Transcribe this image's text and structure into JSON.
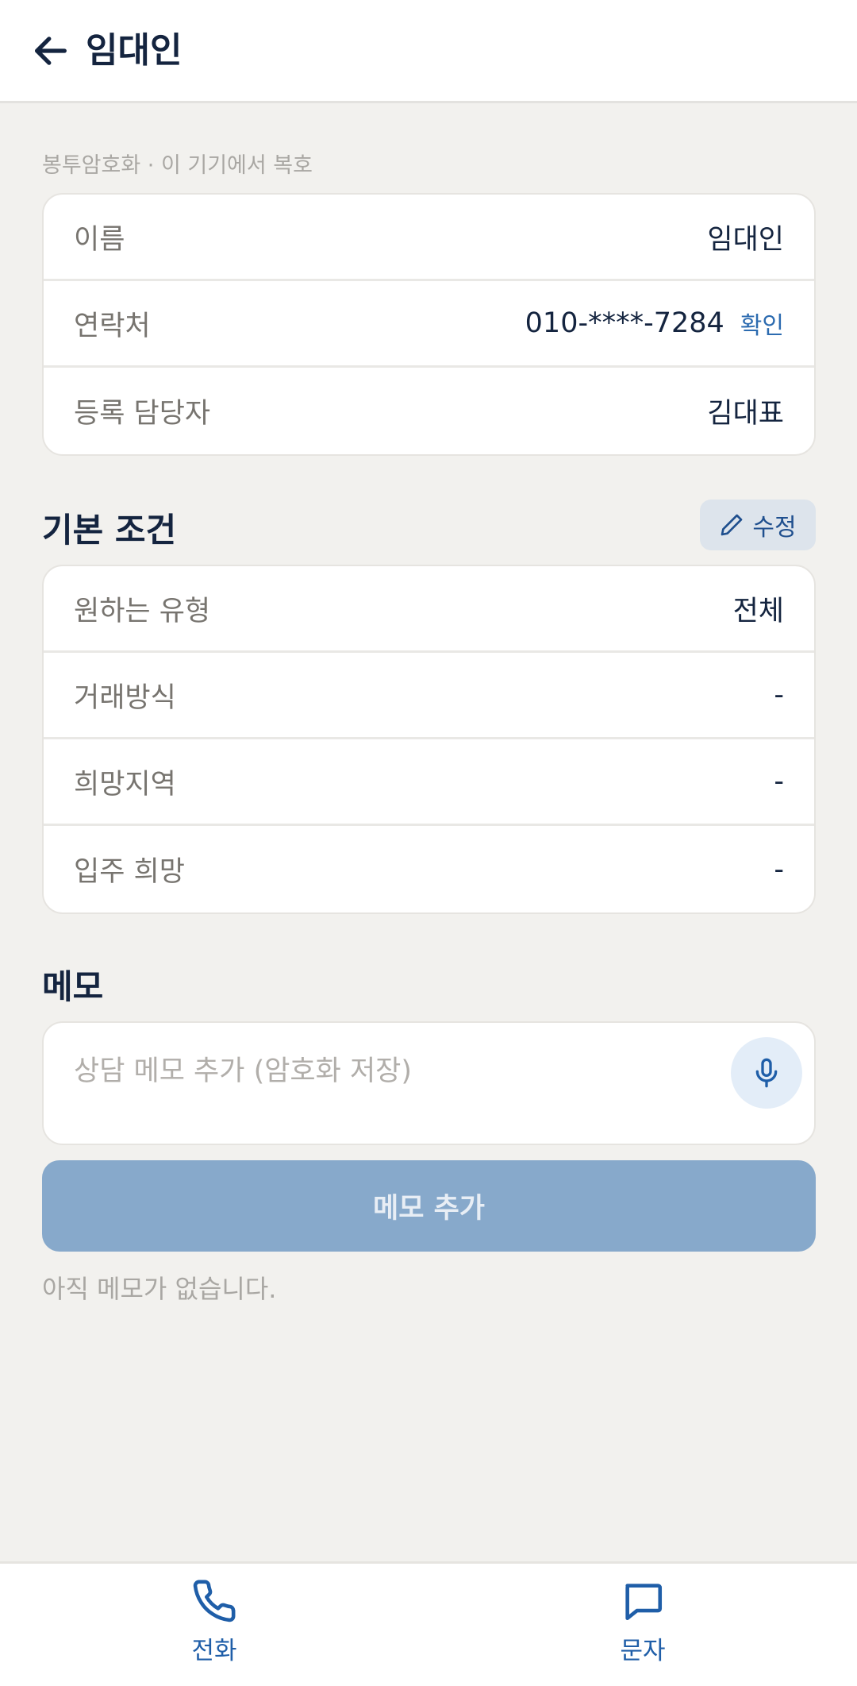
{
  "header": {
    "title": "임대인"
  },
  "encryption_note": "봉투암호화 · 이 기기에서 복호",
  "info_card": {
    "rows": [
      {
        "label": "이름",
        "value": "임대인"
      },
      {
        "label": "연락처",
        "value": "010-****-7284",
        "action": "확인"
      },
      {
        "label": "등록 담당자",
        "value": "김대표"
      }
    ]
  },
  "conditions": {
    "title": "기본 조건",
    "edit_label": "수정",
    "rows": [
      {
        "label": "원하는 유형",
        "value": "전체"
      },
      {
        "label": "거래방식",
        "value": "-"
      },
      {
        "label": "희망지역",
        "value": "-"
      },
      {
        "label": "입주 희망",
        "value": "-"
      }
    ]
  },
  "memo": {
    "title": "메모",
    "placeholder": "상담 메모 추가 (암호화 저장)",
    "add_label": "메모 추가",
    "empty_text": "아직 메모가 없습니다."
  },
  "bottom_bar": {
    "call_label": "전화",
    "message_label": "문자"
  },
  "colors": {
    "accent": "#1f5ea8",
    "navy": "#14243f",
    "background": "#f2f1ee",
    "disabled_button": "#87a9cb"
  },
  "icons": [
    "arrow-left-icon",
    "pencil-icon",
    "microphone-icon",
    "phone-icon",
    "chat-bubble-icon"
  ]
}
